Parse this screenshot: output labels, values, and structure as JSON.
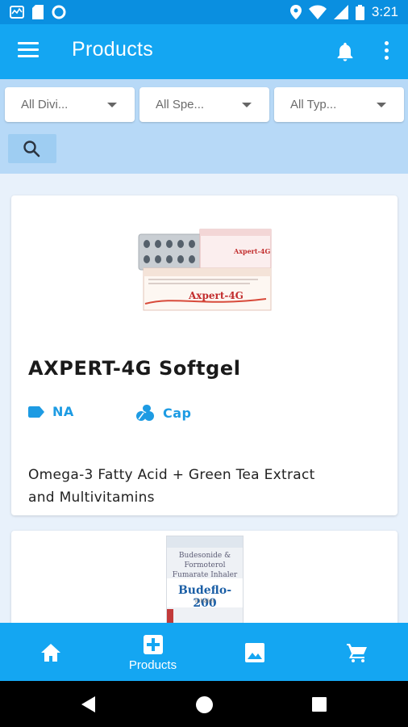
{
  "status_bar": {
    "time": "3:21"
  },
  "app_bar": {
    "title": "Products"
  },
  "filters": {
    "division": "All Divi...",
    "speciality": "All Spe...",
    "type": "All Typ..."
  },
  "products": [
    {
      "name": "AXPERT-4G Softgel",
      "tag_label": "NA",
      "form_label": "Cap",
      "description": "Omega-3 Fatty Acid + Green Tea Extract and Multivitamins",
      "pack_text": "Axpert-4G"
    },
    {
      "pack_text_top": "Budesonide & Formoterol Fumarate Inhaler",
      "pack_text": "Budeflo-200",
      "pack_text_sub": "Inhaler"
    }
  ],
  "bottom_nav": {
    "items": [
      {
        "icon": "home-icon",
        "label": ""
      },
      {
        "icon": "medical-plus-icon",
        "label": "Products"
      },
      {
        "icon": "image-icon",
        "label": ""
      },
      {
        "icon": "cart-icon",
        "label": ""
      }
    ]
  },
  "colors": {
    "primary": "#14a6f2",
    "status_bar": "#0a8fe0",
    "filter_bg": "#b7d9f7",
    "accent_text": "#1d9be3"
  }
}
